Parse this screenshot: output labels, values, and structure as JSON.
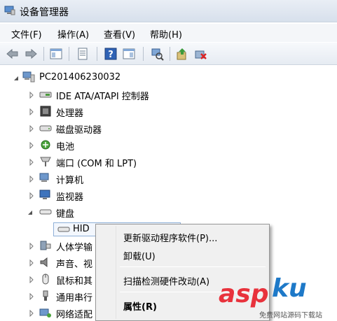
{
  "window": {
    "title": "设备管理器"
  },
  "menu": [
    "文件(F)",
    "操作(A)",
    "查看(V)",
    "帮助(H)"
  ],
  "tree": {
    "root": "PC201406230032",
    "items": [
      "IDE ATA/ATAPI 控制器",
      "处理器",
      "磁盘驱动器",
      "电池",
      "端口 (COM 和 LPT)",
      "计算机",
      "监视器",
      "键盘",
      "HID",
      "人体学输",
      "声音、视",
      "鼠标和其",
      "通用串行",
      "网络适配"
    ]
  },
  "context_menu": {
    "update": "更新驱动程序软件(P)...",
    "uninstall": "卸载(U)",
    "scan": "扫描检测硬件改动(A)",
    "properties": "属性(R)"
  },
  "watermark": {
    "brand_a": "asp",
    "brand_b": "ku",
    "sub": "免费网站源码下载站"
  },
  "colors": {
    "accent": "#3a6ea5",
    "brand_red": "#e8323c",
    "brand_blue": "#1e79c8"
  }
}
